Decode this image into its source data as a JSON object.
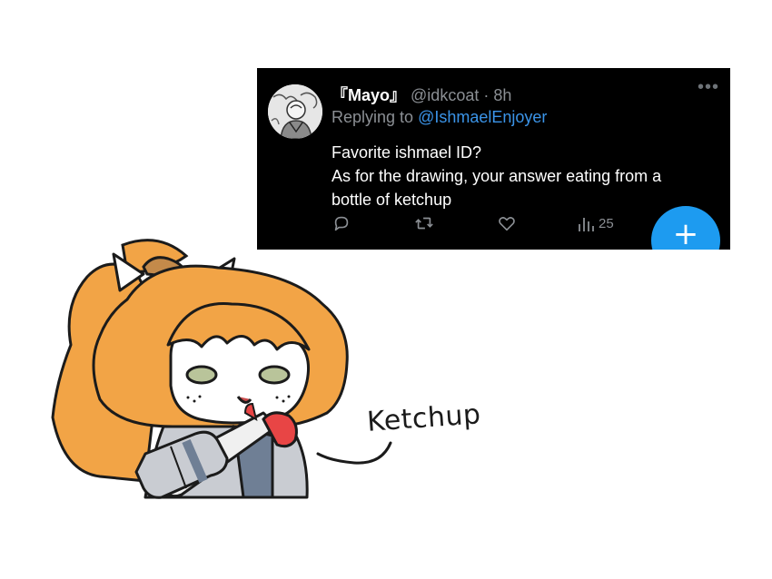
{
  "tweet": {
    "display_name": "『Mayo』",
    "handle": "@idkcoat",
    "separator": "·",
    "time": "8h",
    "replying_prefix": "Replying to ",
    "replying_to": "@IshmaelEnjoyer",
    "text_lines": [
      "Favorite ishmael ID?",
      "As for the drawing, your answer eating from a",
      "bottle of ketchup"
    ],
    "views": "25",
    "more_icon": "more-dots-icon",
    "colors": {
      "background": "#000000",
      "text": "#ffffff",
      "muted": "#8b8f94",
      "link": "#3b94e8",
      "fab": "#1d9bf0"
    }
  },
  "fab": {
    "label": "+",
    "icon": "plus-icon"
  },
  "drawing": {
    "annotation": "Ketchup",
    "colors": {
      "hair": "#f2a446",
      "bottle_cap": "#e84545",
      "coat": "#6f7f95",
      "outline": "#1b1b1b"
    }
  }
}
